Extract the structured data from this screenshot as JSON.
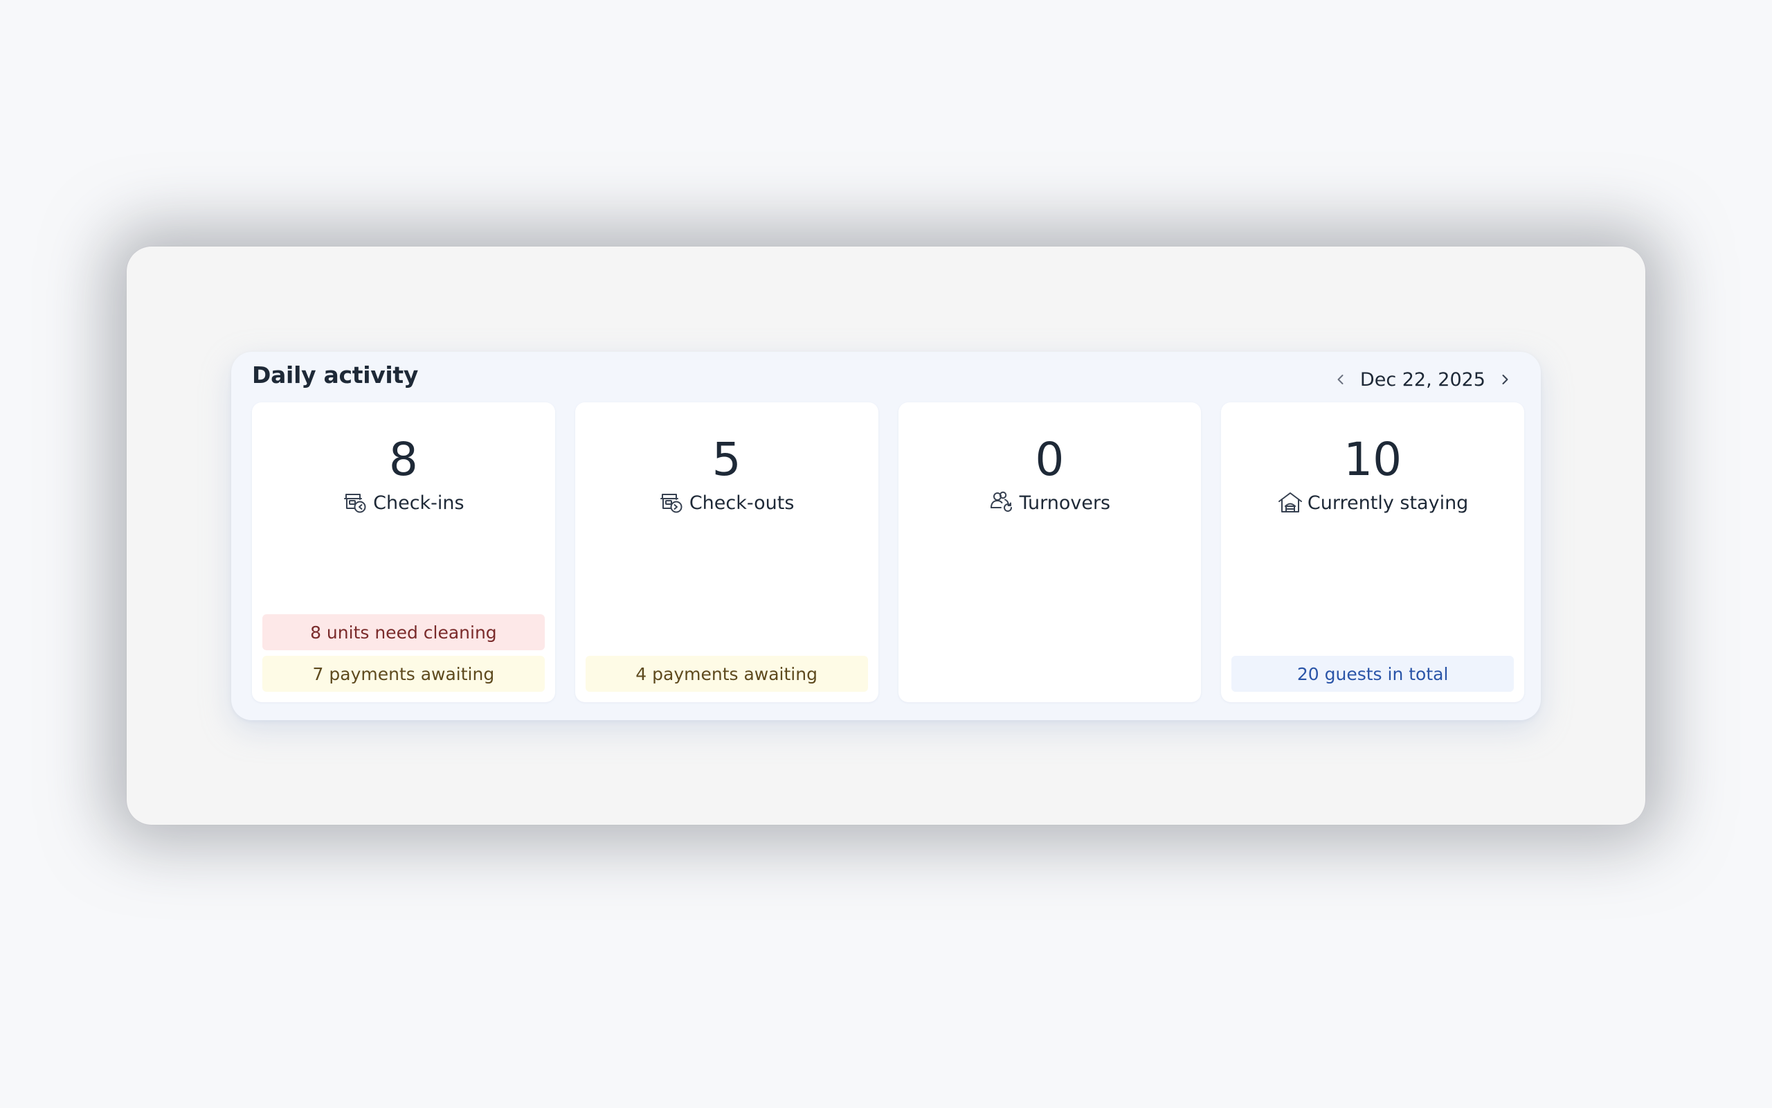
{
  "widget": {
    "title": "Daily activity",
    "date": "Dec 22, 2025"
  },
  "cards": [
    {
      "count": "8",
      "label": "Check-ins",
      "icon": "check-in-icon",
      "badges": [
        {
          "text": "8 units need cleaning",
          "tone": "red"
        },
        {
          "text": "7 payments awaiting",
          "tone": "yellow"
        }
      ]
    },
    {
      "count": "5",
      "label": "Check-outs",
      "icon": "check-out-icon",
      "badges": [
        {
          "text": "4 payments awaiting",
          "tone": "yellow"
        }
      ]
    },
    {
      "count": "0",
      "label": "Turnovers",
      "icon": "turnover-icon",
      "badges": []
    },
    {
      "count": "10",
      "label": "Currently staying",
      "icon": "home-icon",
      "badges": [
        {
          "text": "20 guests in total",
          "tone": "blue"
        }
      ]
    }
  ],
  "colors": {
    "text": "#1e2937",
    "badge_red_bg": "#fde8e8",
    "badge_yellow_bg": "#fefbe6",
    "badge_blue_bg": "#eff4fd",
    "badge_blue_text": "#2b55a8"
  }
}
